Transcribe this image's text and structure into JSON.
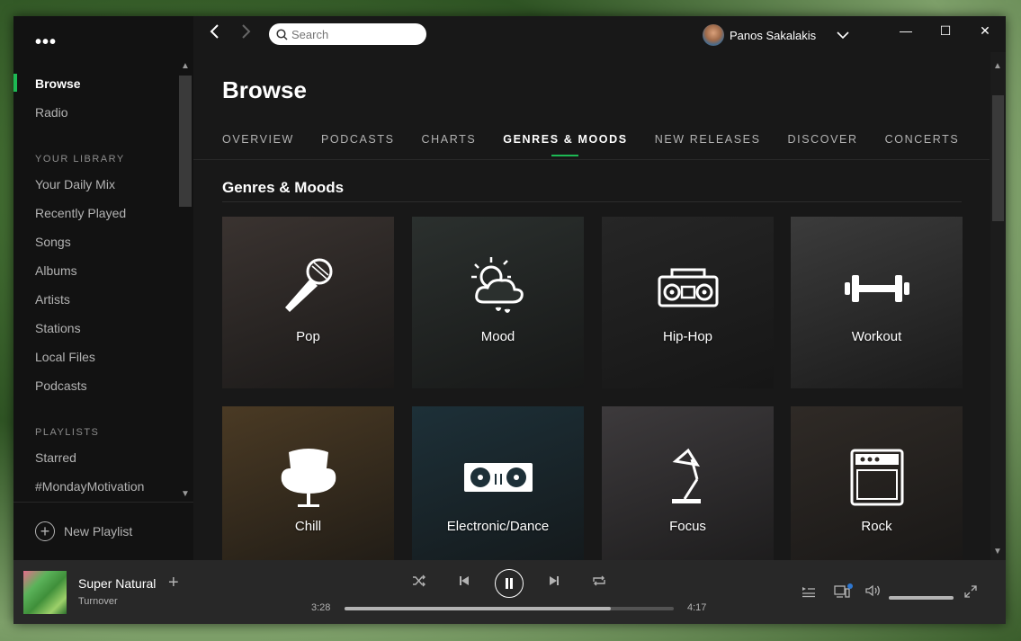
{
  "window": {
    "controls": [
      "—",
      "☐",
      "✕"
    ]
  },
  "sidebar": {
    "menu_dots": "•••",
    "items": [
      {
        "label": "Browse",
        "active": true
      },
      {
        "label": "Radio",
        "active": false
      }
    ],
    "library_heading": "YOUR LIBRARY",
    "library": [
      "Your Daily Mix",
      "Recently Played",
      "Songs",
      "Albums",
      "Artists",
      "Stations",
      "Local Files",
      "Podcasts"
    ],
    "playlists_heading": "PLAYLISTS",
    "playlists": [
      "Starred",
      "#MondayMotivation"
    ],
    "new_playlist": "New Playlist"
  },
  "topbar": {
    "search_placeholder": "Search",
    "user_name": "Panos Sakalakis"
  },
  "page": {
    "title": "Browse",
    "tabs": [
      {
        "label": "OVERVIEW",
        "active": false
      },
      {
        "label": "PODCASTS",
        "active": false
      },
      {
        "label": "CHARTS",
        "active": false
      },
      {
        "label": "GENRES & MOODS",
        "active": true
      },
      {
        "label": "NEW RELEASES",
        "active": false
      },
      {
        "label": "DISCOVER",
        "active": false
      },
      {
        "label": "CONCERTS",
        "active": false
      }
    ],
    "section_title": "Genres & Moods",
    "tiles": [
      {
        "label": "Pop",
        "icon": "microphone-icon",
        "color": "#3a3330"
      },
      {
        "label": "Mood",
        "icon": "weather-icon",
        "color": "#2b302e"
      },
      {
        "label": "Hip-Hop",
        "icon": "boombox-icon",
        "color": "#262626"
      },
      {
        "label": "Workout",
        "icon": "dumbbell-icon",
        "color": "#3b3b3b"
      },
      {
        "label": "Chill",
        "icon": "egg-chair-icon",
        "color": "#4a3a24"
      },
      {
        "label": "Electronic/Dance",
        "icon": "turntables-icon",
        "color": "#1d3038"
      },
      {
        "label": "Focus",
        "icon": "desk-lamp-icon",
        "color": "#3d3a3c"
      },
      {
        "label": "Rock",
        "icon": "amplifier-icon",
        "color": "#2f2a26"
      }
    ]
  },
  "player": {
    "track_title": "Super Natural",
    "track_artist": "Turnover",
    "elapsed": "3:28",
    "duration": "4:17",
    "progress": 0.81,
    "volume": 1.0
  }
}
